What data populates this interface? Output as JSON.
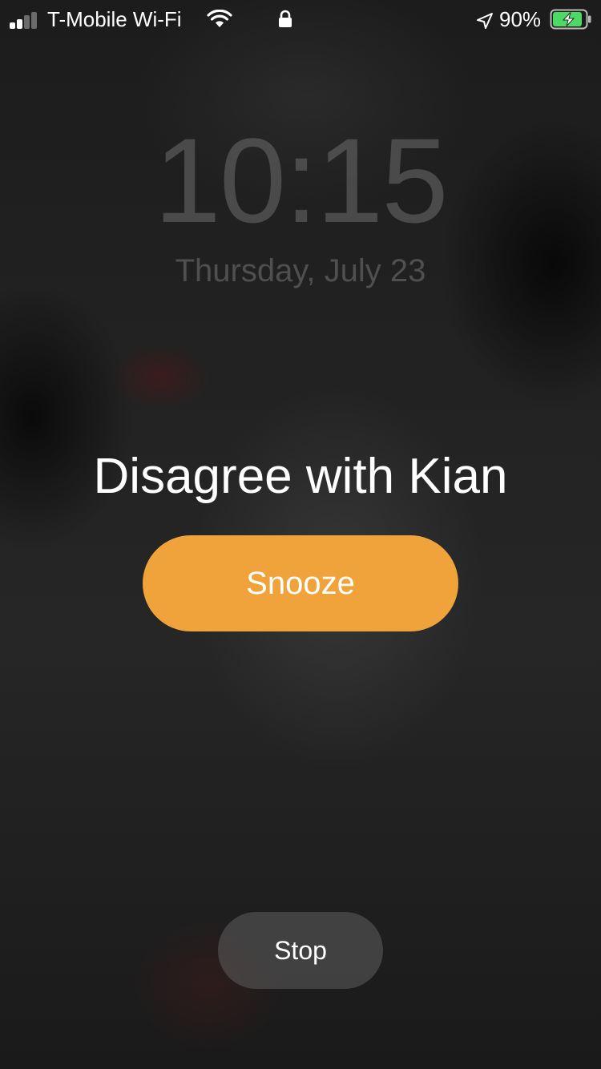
{
  "status_bar": {
    "carrier": "T-Mobile Wi-Fi",
    "signal_bars_filled": 2,
    "signal_bars_total": 4,
    "battery_percent_text": "90%",
    "battery_level": 0.9,
    "battery_charging": true,
    "icons": [
      "signal-icon",
      "wifi-icon",
      "lock-icon",
      "location-arrow-icon",
      "battery-charging-icon"
    ],
    "colors": {
      "battery_fill": "#4cd964"
    }
  },
  "lock_screen": {
    "time": "10:15",
    "date": "Thursday, July 23"
  },
  "alarm": {
    "title": "Disagree with Kian",
    "snooze_label": "Snooze",
    "stop_label": "Stop"
  },
  "colors": {
    "snooze_accent": "#efa33a"
  }
}
